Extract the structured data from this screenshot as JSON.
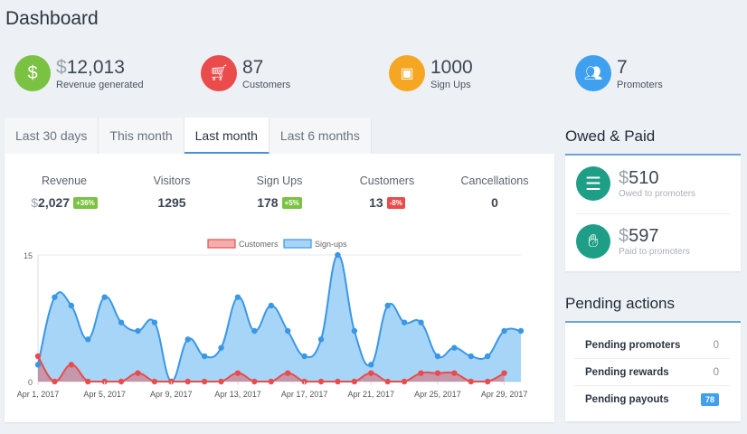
{
  "page_title": "Dashboard",
  "stats": [
    {
      "currency": "$",
      "value": "12,013",
      "label": "Revenue generated",
      "icon": "dollar-icon",
      "color": "#7cc242"
    },
    {
      "currency": "",
      "value": "87",
      "label": "Customers",
      "icon": "cart-icon",
      "color": "#ea4c4c"
    },
    {
      "currency": "",
      "value": "1000",
      "label": "Sign Ups",
      "icon": "contact-book-icon",
      "color": "#f5a623"
    },
    {
      "currency": "",
      "value": "7",
      "label": "Promoters",
      "icon": "users-icon",
      "color": "#3fa0f0"
    }
  ],
  "tabs": [
    {
      "label": "Last 30 days"
    },
    {
      "label": "This month"
    },
    {
      "label": "Last month",
      "active": true
    },
    {
      "label": "Last 6 months"
    }
  ],
  "kpis": [
    {
      "label": "Revenue",
      "currency": "$",
      "value": "2,027",
      "badge": "+36%",
      "badge_color": "#7cc242"
    },
    {
      "label": "Visitors",
      "value": "1295"
    },
    {
      "label": "Sign Ups",
      "value": "178",
      "badge": "+5%",
      "badge_color": "#7cc242"
    },
    {
      "label": "Customers",
      "value": "13",
      "badge": "-8%",
      "badge_color": "#ea4c4c"
    },
    {
      "label": "Cancellations",
      "value": "0"
    }
  ],
  "chart_data": {
    "type": "area",
    "ylim": [
      0,
      15
    ],
    "yticks": [
      "0",
      "15"
    ],
    "x": [
      "Apr 1, 2017",
      "Apr 2, 2017",
      "Apr 3, 2017",
      "Apr 4, 2017",
      "Apr 5, 2017",
      "Apr 6, 2017",
      "Apr 7, 2017",
      "Apr 8, 2017",
      "Apr 9, 2017",
      "Apr 10, 2017",
      "Apr 11, 2017",
      "Apr 12, 2017",
      "Apr 13, 2017",
      "Apr 14, 2017",
      "Apr 15, 2017",
      "Apr 16, 2017",
      "Apr 17, 2017",
      "Apr 18, 2017",
      "Apr 19, 2017",
      "Apr 20, 2017",
      "Apr 21, 2017",
      "Apr 22, 2017",
      "Apr 23, 2017",
      "Apr 24, 2017",
      "Apr 25, 2017",
      "Apr 26, 2017",
      "Apr 27, 2017",
      "Apr 28, 2017",
      "Apr 29, 2017",
      "Apr 30, 2017"
    ],
    "xtick_labels": [
      "Apr 1, 2017",
      "Apr 5, 2017",
      "Apr 9, 2017",
      "Apr 13, 2017",
      "Apr 17, 2017",
      "Apr 21, 2017",
      "Apr 25, 2017",
      "Apr 29, 2017"
    ],
    "legend_position": "top",
    "series": [
      {
        "name": "Customers",
        "color": "#e84c4c",
        "fill": "rgba(232,76,76,0.45)",
        "values": [
          3,
          0,
          2,
          0,
          0,
          0,
          1,
          0,
          0,
          0,
          0,
          0,
          1,
          0,
          0,
          1,
          0,
          0,
          0,
          0,
          1,
          0,
          0,
          1,
          1,
          1,
          0,
          0,
          1
        ]
      },
      {
        "name": "Sign-ups",
        "color": "#3a97e6",
        "fill": "rgba(120,190,245,0.65)",
        "values": [
          2,
          10,
          9,
          5,
          10,
          7,
          6,
          7,
          0,
          5,
          3,
          4,
          10,
          6,
          9,
          6,
          3,
          5,
          15,
          6,
          2,
          9,
          7,
          7,
          3,
          4,
          3,
          3,
          6,
          6
        ]
      }
    ]
  },
  "owed_paid": {
    "title": "Owed & Paid",
    "items": [
      {
        "currency": "$",
        "amount": "510",
        "label": "Owed to promoters",
        "icon": "coins-icon"
      },
      {
        "currency": "$",
        "amount": "597",
        "label": "Paid to promoters",
        "icon": "hand-coins-icon"
      }
    ]
  },
  "pending": {
    "title": "Pending actions",
    "items": [
      {
        "label": "Pending promoters",
        "count": "0"
      },
      {
        "label": "Pending rewards",
        "count": "0"
      },
      {
        "label": "Pending payouts",
        "count": "78",
        "highlight": true
      }
    ]
  }
}
